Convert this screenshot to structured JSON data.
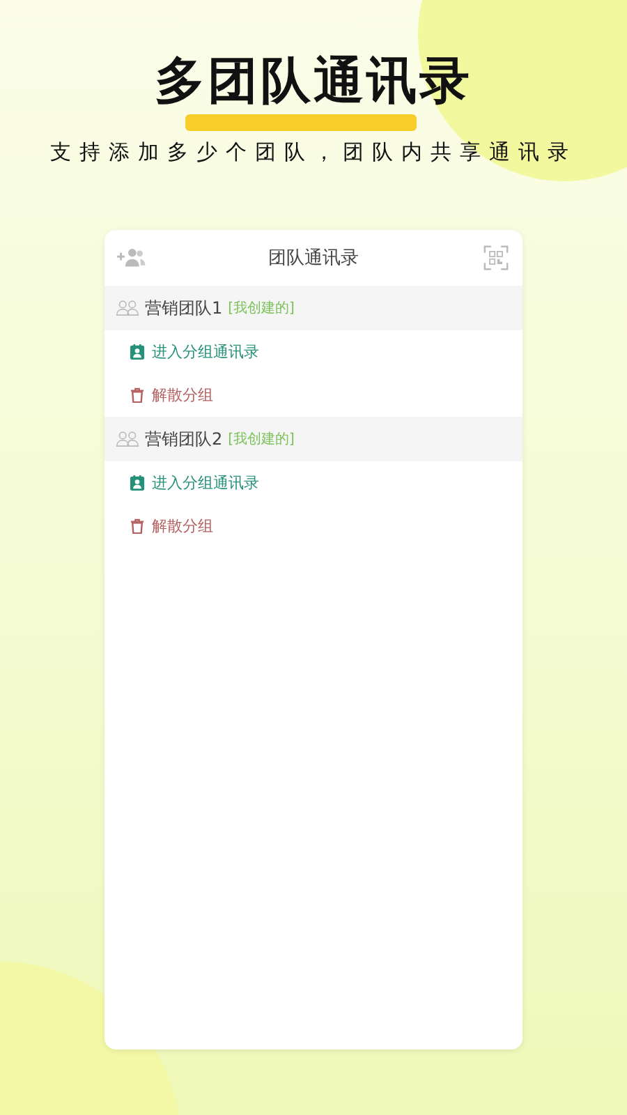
{
  "headline": "多团队通讯录",
  "subtitle": "支持添加多少个团队，团队内共享通讯录",
  "screen": {
    "title": "团队通讯录",
    "teams": [
      {
        "name": "营销团队1",
        "tag": "[我创建的]",
        "actions": [
          {
            "kind": "enter",
            "label": "进入分组通讯录"
          },
          {
            "kind": "dissolve",
            "label": "解散分组"
          }
        ]
      },
      {
        "name": "营销团队2",
        "tag": "[我创建的]",
        "actions": [
          {
            "kind": "enter",
            "label": "进入分组通讯录"
          },
          {
            "kind": "dissolve",
            "label": "解散分组"
          }
        ]
      }
    ]
  }
}
